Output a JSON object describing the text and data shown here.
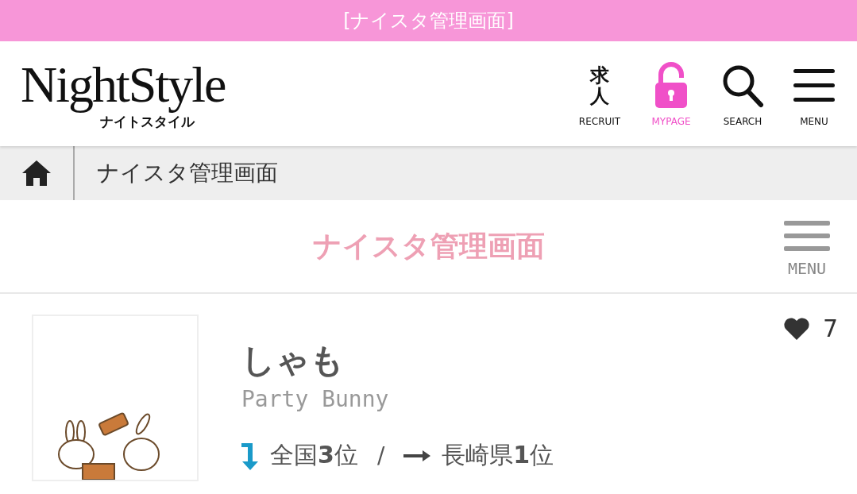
{
  "top_bar": {
    "title": "[ナイスタ管理画面]"
  },
  "header": {
    "logo": {
      "main": "NightStyle",
      "sub": "ナイトスタイル"
    },
    "nav": [
      {
        "kind": "recruit",
        "glyph": "求人",
        "label": "RECRUIT",
        "selected": false
      },
      {
        "kind": "mypage",
        "label": "MYPAGE",
        "selected": true
      },
      {
        "kind": "search",
        "label": "SEARCH",
        "selected": false
      },
      {
        "kind": "menu",
        "label": "MENU",
        "selected": false
      }
    ]
  },
  "breadcrumb": {
    "items": [
      "ナイスタ管理画面"
    ]
  },
  "page_title": {
    "title": "ナイスタ管理画面",
    "menu_label": "MENU"
  },
  "profile": {
    "name": "しゃも",
    "shop": "Party Bunny",
    "likes": "7",
    "ranks": [
      {
        "kind": "down",
        "text": "全国**3**位"
      },
      {
        "kind": "flat",
        "text": "長崎県**1**位"
      }
    ],
    "separator": "/"
  }
}
